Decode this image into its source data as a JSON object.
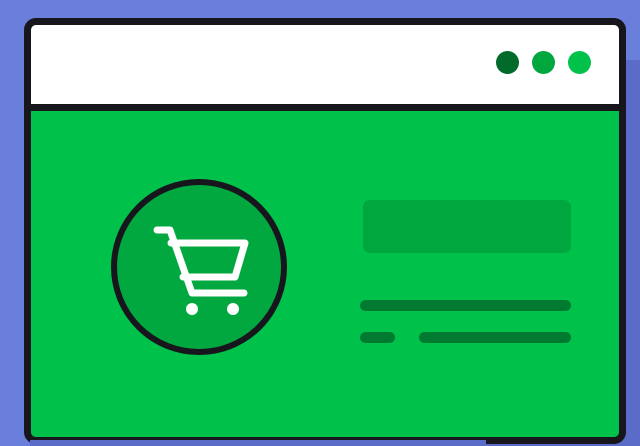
{
  "illustration": {
    "subject": "browser-window-with-shopping-cart",
    "colors": {
      "background": "#6A7FDB",
      "window_border": "#16161C",
      "titlebar": "#FFFFFF",
      "content": "#00C24B",
      "badge": "#01A83F",
      "cart": "#FFFFFF",
      "window_dots": [
        "#006B2A",
        "#00A63E",
        "#00C24B"
      ],
      "placeholder": "#00A63E",
      "text_lines": "#007A30"
    },
    "icons": [
      "shopping-cart-icon"
    ]
  }
}
